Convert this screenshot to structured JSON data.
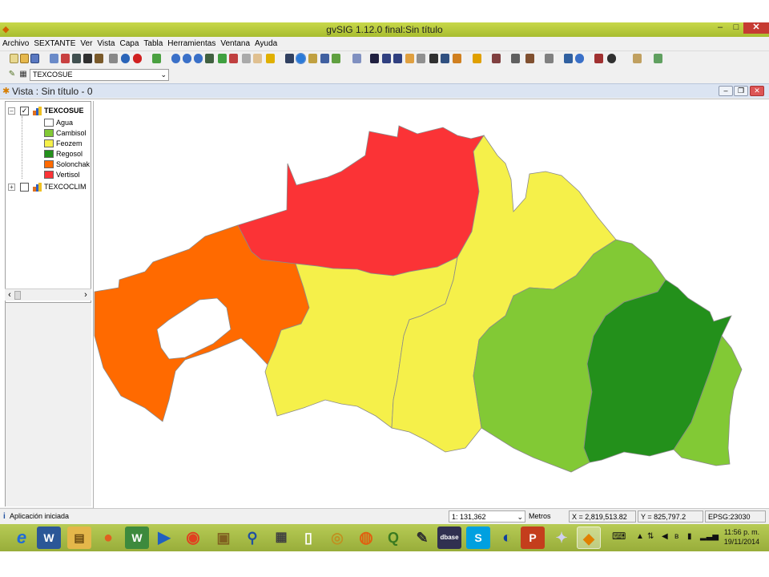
{
  "window": {
    "title": "gvSIG 1.12.0 final:Sin título",
    "minimize_glyph": "–",
    "maximize_glyph": "□",
    "close_glyph": "✕"
  },
  "menu": [
    "Archivo",
    "SEXTANTE",
    "Ver",
    "Vista",
    "Capa",
    "Tabla",
    "Herramientas",
    "Ventana",
    "Ayuda"
  ],
  "layer_selector": {
    "value": "TEXCOSUE"
  },
  "view": {
    "title": "Vista : Sin título - 0"
  },
  "toc": {
    "layers": [
      {
        "name": "TEXCOSUE",
        "checked": true,
        "expanded": true,
        "legend": [
          {
            "label": "Agua",
            "color": "#ffffff"
          },
          {
            "label": "Cambisol",
            "color": "#82c935"
          },
          {
            "label": "Feozem",
            "color": "#f5f04a"
          },
          {
            "label": "Regosol",
            "color": "#23901b"
          },
          {
            "label": "Solonchak",
            "color": "#ff6a00"
          },
          {
            "label": "Vertisol",
            "color": "#fb3336"
          }
        ]
      },
      {
        "name": "TEXCOCLIM",
        "checked": false,
        "expanded": false
      }
    ]
  },
  "status": {
    "message": "Aplicación iniciada",
    "scale": "1: 131,362",
    "units": "Metros",
    "x": "X = 2,819,513.82",
    "y": "Y = 825,797.2",
    "epsg": "EPSG:23030"
  },
  "clock": {
    "time": "11:56 p. m.",
    "date": "19/11/2014"
  },
  "colors": {
    "title_bar": "#b5c83a",
    "taskbar": "#a9bf4a",
    "close_button": "#c63b32"
  }
}
